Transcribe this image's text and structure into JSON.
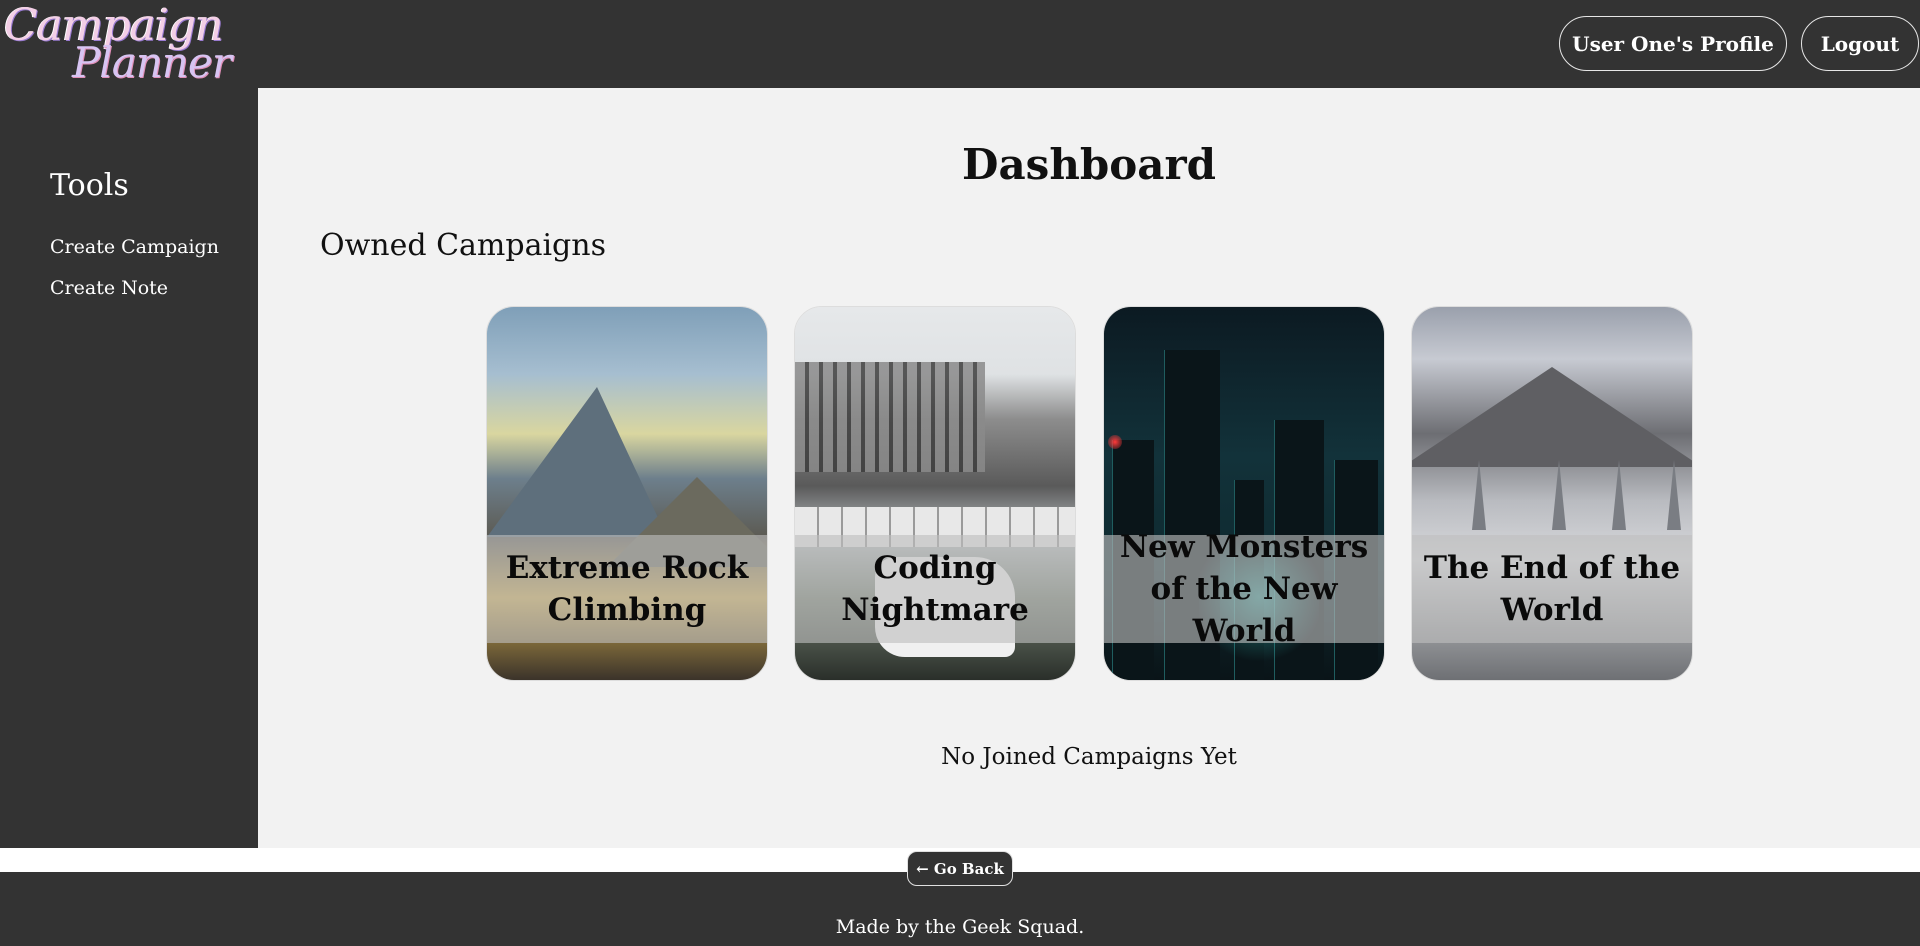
{
  "header": {
    "logo": {
      "line1": "Campaign",
      "line2": "Planner"
    },
    "profile_button": "User One's Profile",
    "logout_button": "Logout"
  },
  "sidebar": {
    "title": "Tools",
    "links": [
      "Create Campaign",
      "Create Note"
    ]
  },
  "main": {
    "title": "Dashboard",
    "owned_title": "Owned Campaigns",
    "campaigns": [
      {
        "title": "Extreme Rock Climbing"
      },
      {
        "title": "Coding Nightmare"
      },
      {
        "title": "New Monsters of the New World"
      },
      {
        "title": "The End of the World"
      }
    ],
    "no_joined": "No Joined Campaigns Yet"
  },
  "footer": {
    "go_back": "← Go Back",
    "credit": "Made by the Geek Squad."
  },
  "colors": {
    "chrome_dark": "#333333",
    "main_bg": "#f2f2f2",
    "text_dark": "#111111"
  }
}
